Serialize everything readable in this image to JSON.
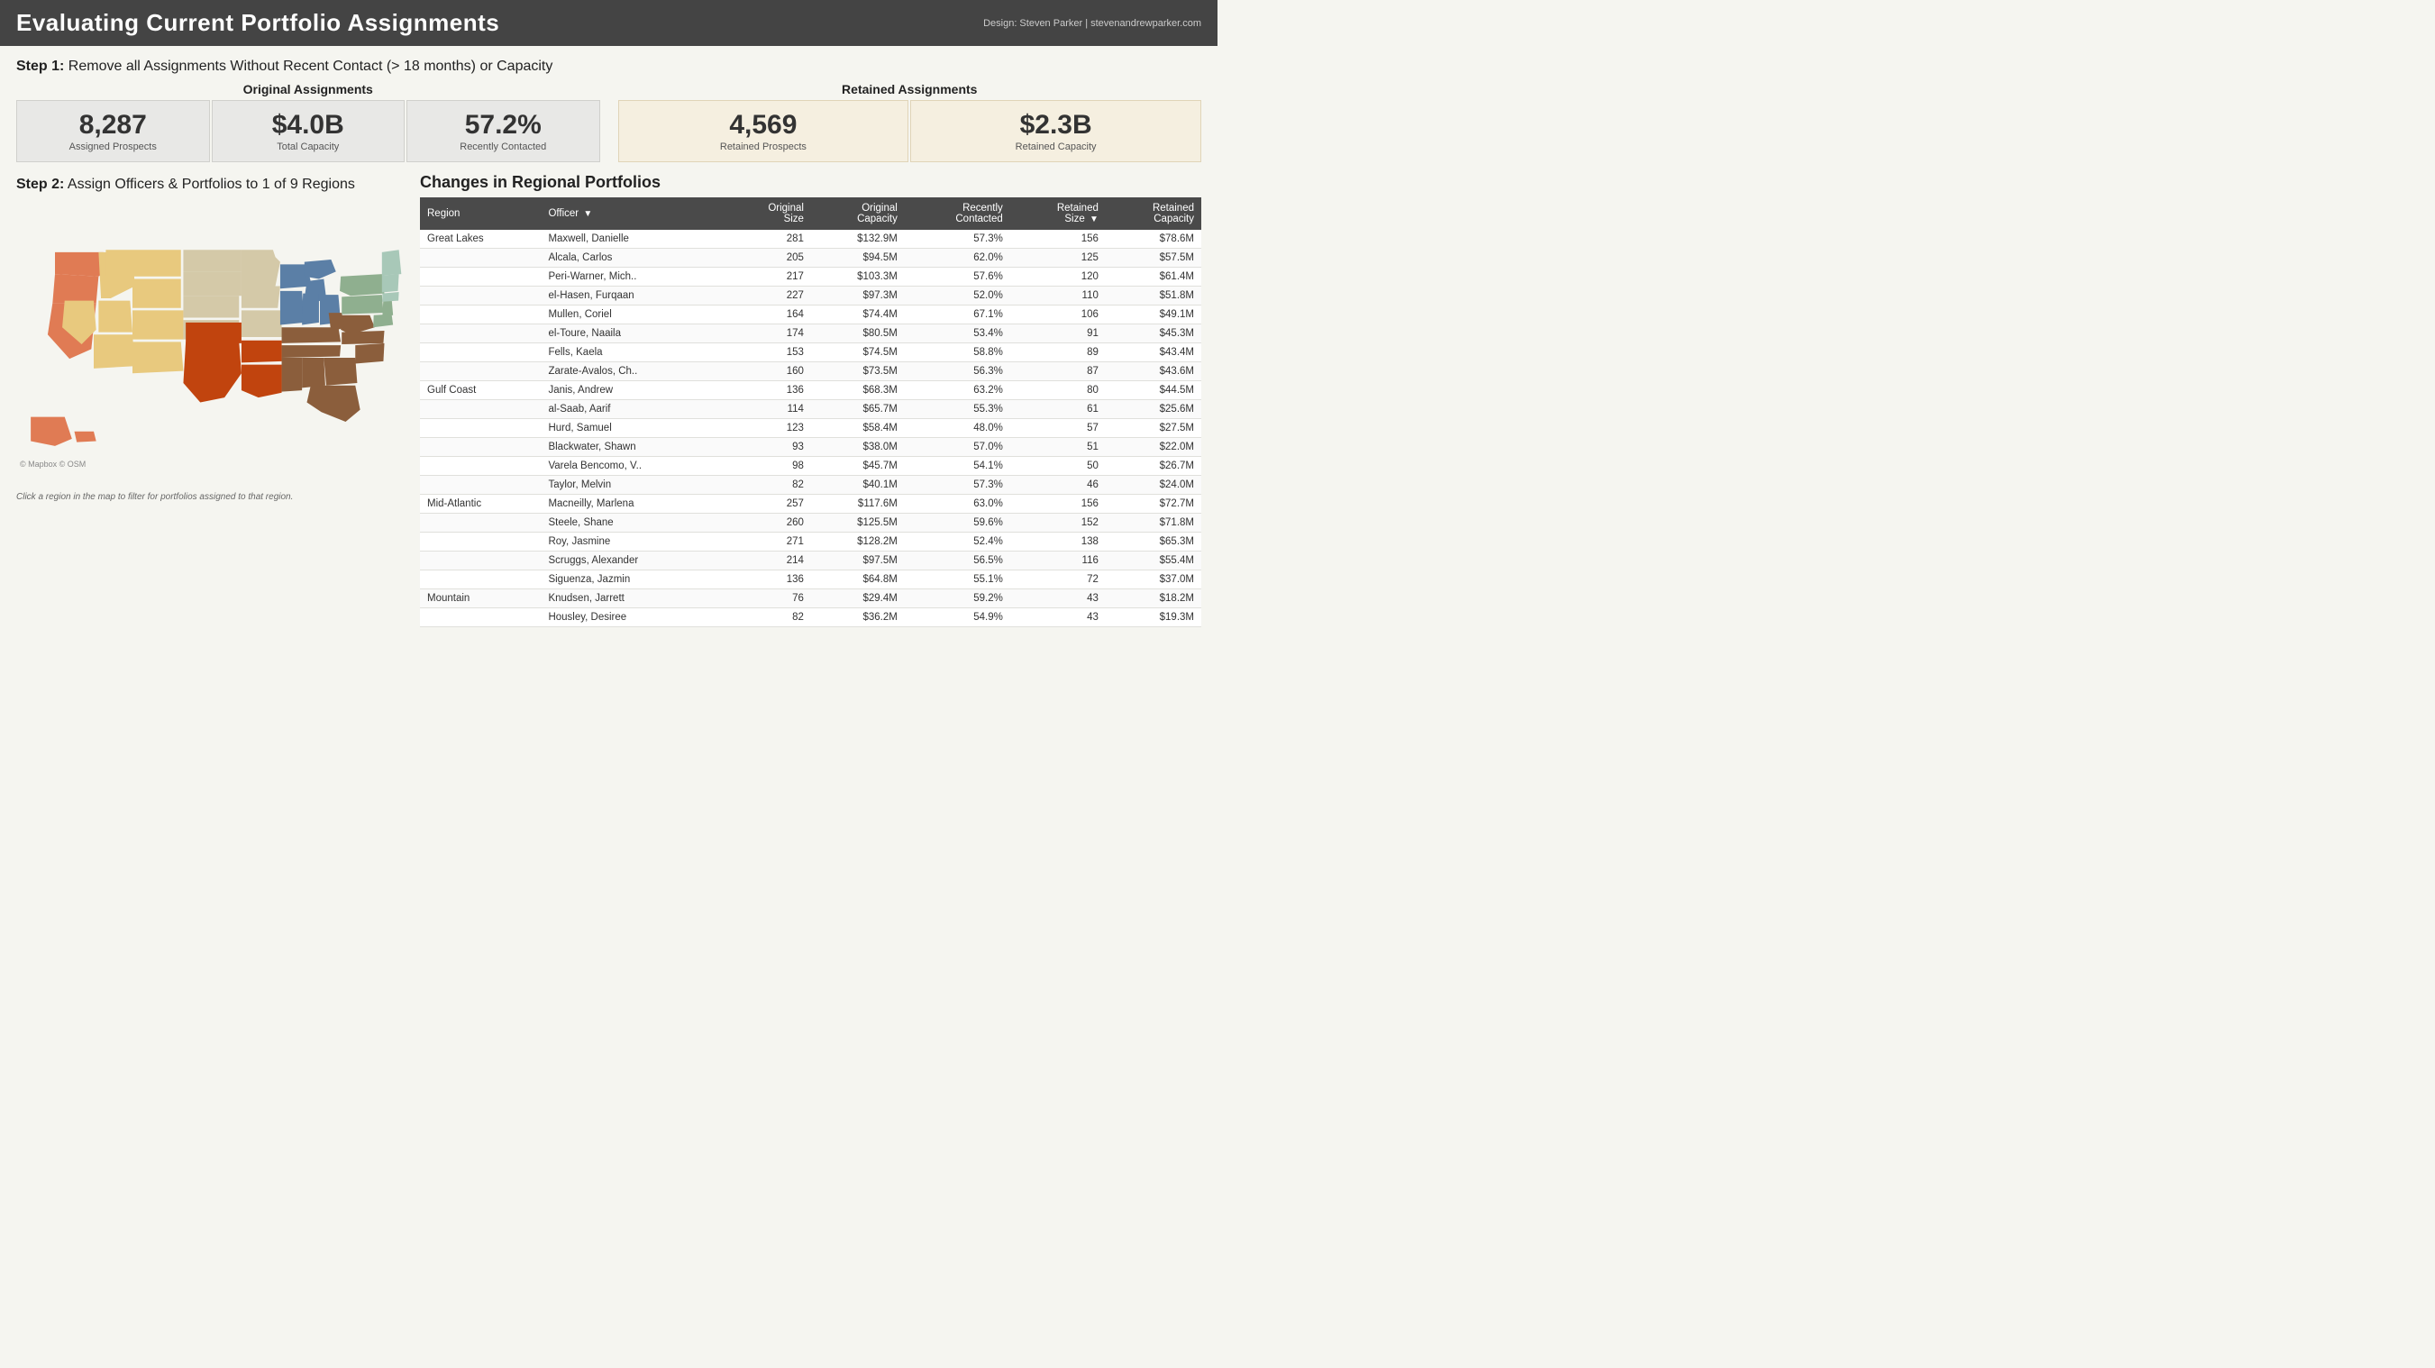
{
  "header": {
    "title": "Evaluating Current Portfolio Assignments",
    "credit": "Design: Steven Parker | stevenandrewparker.com"
  },
  "step1": {
    "label": "Step 1:",
    "description": "Remove all Assignments Without Recent Contact (> 18 months) or Capacity"
  },
  "step2": {
    "label": "Step 2:",
    "description": "Assign Officers & Portfolios to 1 of 9 Regions"
  },
  "original_assignments": {
    "title": "Original Assignments",
    "cards": [
      {
        "value": "8,287",
        "label": "Assigned Prospects"
      },
      {
        "value": "$4.0B",
        "label": "Total Capacity"
      },
      {
        "value": "57.2%",
        "label": "Recently Contacted"
      }
    ]
  },
  "retained_assignments": {
    "title": "Retained Assignments",
    "cards": [
      {
        "value": "4,569",
        "label": "Retained Prospects"
      },
      {
        "value": "$2.3B",
        "label": "Retained Capacity"
      }
    ]
  },
  "table": {
    "title": "Changes in Regional Portfolios",
    "columns": [
      {
        "label": "Region",
        "key": "region"
      },
      {
        "label": "Officer",
        "key": "officer"
      },
      {
        "label": "Original Size",
        "key": "original_size",
        "num": true
      },
      {
        "label": "Original Capacity",
        "key": "original_capacity",
        "num": true
      },
      {
        "label": "Recently Contacted",
        "key": "recently_contacted",
        "num": true
      },
      {
        "label": "Retained Size",
        "key": "retained_size",
        "num": true
      },
      {
        "label": "Retained Capacity",
        "key": "retained_capacity",
        "num": true
      }
    ],
    "rows": [
      {
        "region": "Great Lakes",
        "officer": "Maxwell, Danielle",
        "original_size": "281",
        "original_capacity": "$132.9M",
        "recently_contacted": "57.3%",
        "retained_size": "156",
        "retained_capacity": "$78.6M"
      },
      {
        "region": "",
        "officer": "Alcala, Carlos",
        "original_size": "205",
        "original_capacity": "$94.5M",
        "recently_contacted": "62.0%",
        "retained_size": "125",
        "retained_capacity": "$57.5M"
      },
      {
        "region": "",
        "officer": "Peri-Warner, Mich..",
        "original_size": "217",
        "original_capacity": "$103.3M",
        "recently_contacted": "57.6%",
        "retained_size": "120",
        "retained_capacity": "$61.4M"
      },
      {
        "region": "",
        "officer": "el-Hasen, Furqaan",
        "original_size": "227",
        "original_capacity": "$97.3M",
        "recently_contacted": "52.0%",
        "retained_size": "110",
        "retained_capacity": "$51.8M"
      },
      {
        "region": "",
        "officer": "Mullen, Coriel",
        "original_size": "164",
        "original_capacity": "$74.4M",
        "recently_contacted": "67.1%",
        "retained_size": "106",
        "retained_capacity": "$49.1M"
      },
      {
        "region": "",
        "officer": "el-Toure, Naaila",
        "original_size": "174",
        "original_capacity": "$80.5M",
        "recently_contacted": "53.4%",
        "retained_size": "91",
        "retained_capacity": "$45.3M"
      },
      {
        "region": "",
        "officer": "Fells, Kaela",
        "original_size": "153",
        "original_capacity": "$74.5M",
        "recently_contacted": "58.8%",
        "retained_size": "89",
        "retained_capacity": "$43.4M"
      },
      {
        "region": "",
        "officer": "Zarate-Avalos, Ch..",
        "original_size": "160",
        "original_capacity": "$73.5M",
        "recently_contacted": "56.3%",
        "retained_size": "87",
        "retained_capacity": "$43.6M"
      },
      {
        "region": "Gulf Coast",
        "officer": "Janis, Andrew",
        "original_size": "136",
        "original_capacity": "$68.3M",
        "recently_contacted": "63.2%",
        "retained_size": "80",
        "retained_capacity": "$44.5M"
      },
      {
        "region": "",
        "officer": "al-Saab, Aarif",
        "original_size": "114",
        "original_capacity": "$65.7M",
        "recently_contacted": "55.3%",
        "retained_size": "61",
        "retained_capacity": "$25.6M"
      },
      {
        "region": "",
        "officer": "Hurd, Samuel",
        "original_size": "123",
        "original_capacity": "$58.4M",
        "recently_contacted": "48.0%",
        "retained_size": "57",
        "retained_capacity": "$27.5M"
      },
      {
        "region": "",
        "officer": "Blackwater, Shawn",
        "original_size": "93",
        "original_capacity": "$38.0M",
        "recently_contacted": "57.0%",
        "retained_size": "51",
        "retained_capacity": "$22.0M"
      },
      {
        "region": "",
        "officer": "Varela Bencomo, V..",
        "original_size": "98",
        "original_capacity": "$45.7M",
        "recently_contacted": "54.1%",
        "retained_size": "50",
        "retained_capacity": "$26.7M"
      },
      {
        "region": "",
        "officer": "Taylor, Melvin",
        "original_size": "82",
        "original_capacity": "$40.1M",
        "recently_contacted": "57.3%",
        "retained_size": "46",
        "retained_capacity": "$24.0M"
      },
      {
        "region": "Mid-Atlantic",
        "officer": "Macneilly, Marlena",
        "original_size": "257",
        "original_capacity": "$117.6M",
        "recently_contacted": "63.0%",
        "retained_size": "156",
        "retained_capacity": "$72.7M"
      },
      {
        "region": "",
        "officer": "Steele, Shane",
        "original_size": "260",
        "original_capacity": "$125.5M",
        "recently_contacted": "59.6%",
        "retained_size": "152",
        "retained_capacity": "$71.8M"
      },
      {
        "region": "",
        "officer": "Roy, Jasmine",
        "original_size": "271",
        "original_capacity": "$128.2M",
        "recently_contacted": "52.4%",
        "retained_size": "138",
        "retained_capacity": "$65.3M"
      },
      {
        "region": "",
        "officer": "Scruggs, Alexander",
        "original_size": "214",
        "original_capacity": "$97.5M",
        "recently_contacted": "56.5%",
        "retained_size": "116",
        "retained_capacity": "$55.4M"
      },
      {
        "region": "",
        "officer": "Siguenza, Jazmin",
        "original_size": "136",
        "original_capacity": "$64.8M",
        "recently_contacted": "55.1%",
        "retained_size": "72",
        "retained_capacity": "$37.0M"
      },
      {
        "region": "Mountain",
        "officer": "Knudsen, Jarrett",
        "original_size": "76",
        "original_capacity": "$29.4M",
        "recently_contacted": "59.2%",
        "retained_size": "43",
        "retained_capacity": "$18.2M"
      },
      {
        "region": "",
        "officer": "Housley, Desiree",
        "original_size": "82",
        "original_capacity": "$36.2M",
        "recently_contacted": "54.9%",
        "retained_size": "43",
        "retained_capacity": "$19.3M"
      }
    ]
  },
  "map_caption": "Click a region in the map to filter for portfolios assigned to that region.",
  "map_copyright": "© Mapbox © OSM"
}
